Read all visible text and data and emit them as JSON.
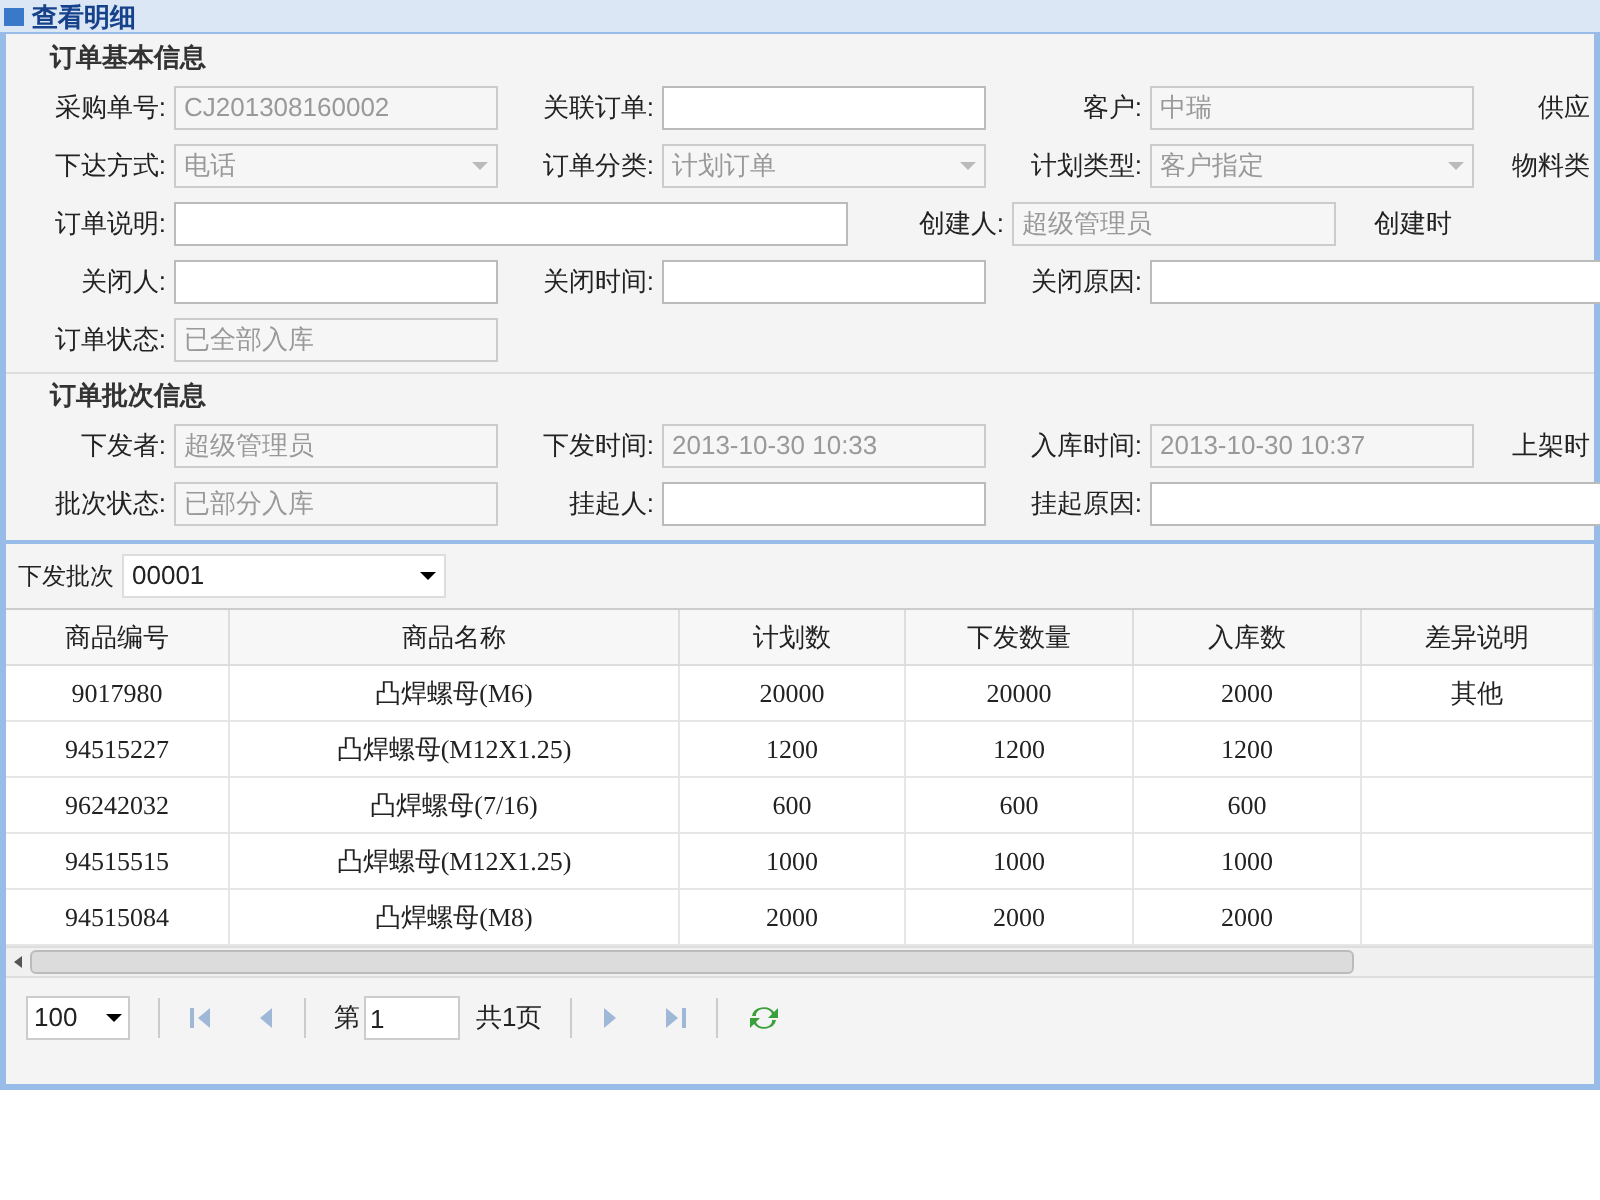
{
  "window": {
    "title": "查看明细"
  },
  "groups": [
    {
      "title": "订单基本信息",
      "rows": [
        [
          {
            "label": "采购单号:",
            "kind": "text",
            "value": "CJ201308160002",
            "disabled": true
          },
          {
            "label": "关联订单:",
            "kind": "text",
            "disabled": false
          },
          {
            "label": "客户:",
            "kind": "text",
            "value": "中瑞",
            "disabled": true
          },
          {
            "label": "供应",
            "kind": "cut"
          }
        ],
        [
          {
            "label": "下达方式:",
            "kind": "select",
            "value": "电话",
            "disabled": true
          },
          {
            "label": "订单分类:",
            "kind": "select",
            "value": "计划订单",
            "disabled": true
          },
          {
            "label": "计划类型:",
            "kind": "select",
            "value": "客户指定",
            "disabled": true
          },
          {
            "label": "物料类",
            "kind": "cut"
          }
        ],
        [
          {
            "label": "订单说明:",
            "kind": "wide",
            "disabled": false
          },
          {
            "label": "创建人:",
            "kind": "text",
            "value": "超级管理员",
            "disabled": true
          },
          {
            "label": "创建时",
            "kind": "cut"
          }
        ],
        [
          {
            "label": "关闭人:",
            "kind": "text",
            "disabled": false
          },
          {
            "label": "关闭时间:",
            "kind": "text",
            "disabled": false
          },
          {
            "label": "关闭原因:",
            "kind": "open",
            "disabled": false
          }
        ],
        [
          {
            "label": "订单状态:",
            "kind": "text",
            "value": "已全部入库",
            "disabled": true
          }
        ]
      ]
    },
    {
      "title": "订单批次信息",
      "rows": [
        [
          {
            "label": "下发者:",
            "kind": "text",
            "value": "超级管理员",
            "disabled": true
          },
          {
            "label": "下发时间:",
            "kind": "text",
            "value": "2013-10-30 10:33",
            "disabled": true
          },
          {
            "label": "入库时间:",
            "kind": "text",
            "value": "2013-10-30 10:37",
            "disabled": true
          },
          {
            "label": "上架时",
            "kind": "cut"
          }
        ],
        [
          {
            "label": "批次状态:",
            "kind": "text",
            "value": "已部分入库",
            "disabled": true
          },
          {
            "label": "挂起人:",
            "kind": "text",
            "disabled": false
          },
          {
            "label": "挂起原因:",
            "kind": "open",
            "disabled": false
          }
        ]
      ]
    }
  ],
  "batch": {
    "label": "下发批次",
    "value": "00001"
  },
  "table": {
    "columns": [
      "商品编号",
      "商品名称",
      "计划数",
      "下发数量",
      "入库数",
      "差异说明"
    ],
    "rows": [
      [
        "9017980",
        "凸焊螺母(M6)",
        "20000",
        "20000",
        "2000",
        "其他"
      ],
      [
        "94515227",
        "凸焊螺母(M12X1.25)",
        "1200",
        "1200",
        "1200",
        ""
      ],
      [
        "96242032",
        "凸焊螺母(7/16)",
        "600",
        "600",
        "600",
        ""
      ],
      [
        "94515515",
        "凸焊螺母(M12X1.25)",
        "1000",
        "1000",
        "1000",
        ""
      ],
      [
        "94515084",
        "凸焊螺母(M8)",
        "2000",
        "2000",
        "2000",
        ""
      ]
    ]
  },
  "pager": {
    "page_size": "100",
    "page_prefix": "第",
    "page": "1",
    "total": "共1页"
  }
}
